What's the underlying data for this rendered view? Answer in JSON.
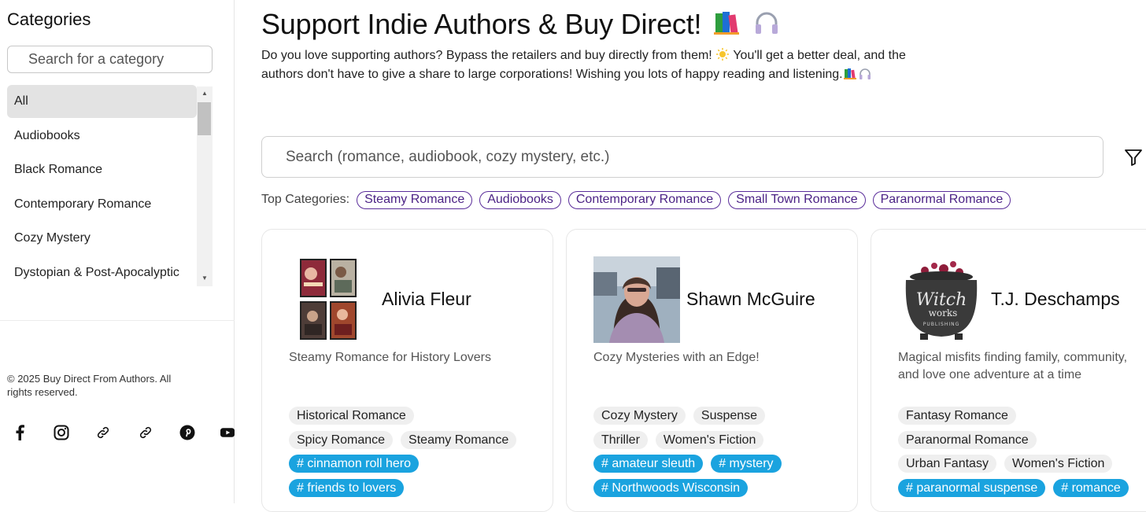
{
  "sidebar": {
    "title": "Categories",
    "search_placeholder": "Search for a category",
    "categories": [
      {
        "label": "All",
        "active": true
      },
      {
        "label": "Audiobooks"
      },
      {
        "label": "Black Romance"
      },
      {
        "label": "Contemporary Romance"
      },
      {
        "label": "Cozy Mystery"
      },
      {
        "label": "Dystopian & Post-Apocalyptic"
      }
    ],
    "copyright": "© 2025 Buy Direct From Authors. All rights reserved.",
    "socials": [
      "facebook-icon",
      "instagram-icon",
      "link-icon",
      "link-icon",
      "pinterest-icon",
      "youtube-icon"
    ]
  },
  "header": {
    "title": "Support Indie Authors & Buy Direct!",
    "title_emojis": [
      "books-icon",
      "headphones-icon"
    ],
    "intro_part1": "Do you love supporting authors? Bypass the retailers and buy directly from them! ",
    "intro_part2": " You'll get a better deal, and the authors don't have to give a share to large corporations! Wishing you lots of happy reading and listening.",
    "intro_emojis": [
      "sun-icon",
      "books-icon",
      "headphones-icon"
    ]
  },
  "search": {
    "placeholder": "Search (romance, audiobook, cozy mystery, etc.)"
  },
  "top_categories": {
    "label": "Top Categories:",
    "items": [
      "Steamy Romance",
      "Audiobooks",
      "Contemporary Romance",
      "Small Town Romance",
      "Paranormal Romance"
    ]
  },
  "authors": [
    {
      "name": "Alivia Fleur",
      "tagline": "Steamy Romance for History Lovers",
      "tag_rows": [
        [
          "Historical Romance"
        ],
        [
          "Spicy Romance",
          "Steamy Romance"
        ]
      ],
      "hashtag_rows": [
        [
          "# cinnamon roll hero"
        ],
        [
          "# friends to lovers"
        ]
      ]
    },
    {
      "name": "Shawn McGuire",
      "tagline": "Cozy Mysteries with an Edge!",
      "tag_rows": [
        [
          "Cozy Mystery",
          "Suspense"
        ],
        [
          "Thriller",
          "Women's Fiction"
        ]
      ],
      "hashtag_rows": [
        [
          "# amateur sleuth",
          "# mystery"
        ],
        [
          "# Northwoods Wisconsin"
        ]
      ]
    },
    {
      "name": "T.J. Deschamps",
      "tagline": "Magical misfits finding family, community, and love one adventure at a time",
      "logo_text_1": "Witch",
      "logo_text_2": "works",
      "logo_text_3": "PUBLISHING",
      "tag_rows": [
        [
          "Fantasy Romance"
        ],
        [
          "Paranormal Romance"
        ],
        [
          "Urban Fantasy",
          "Women's Fiction"
        ]
      ],
      "hashtag_rows": [
        [
          "# paranormal suspense",
          "# romance"
        ]
      ]
    }
  ],
  "colors": {
    "pill_border": "#5a2d9a",
    "hashtag_bg": "#1aa3df",
    "tag_bg": "#efefef"
  }
}
